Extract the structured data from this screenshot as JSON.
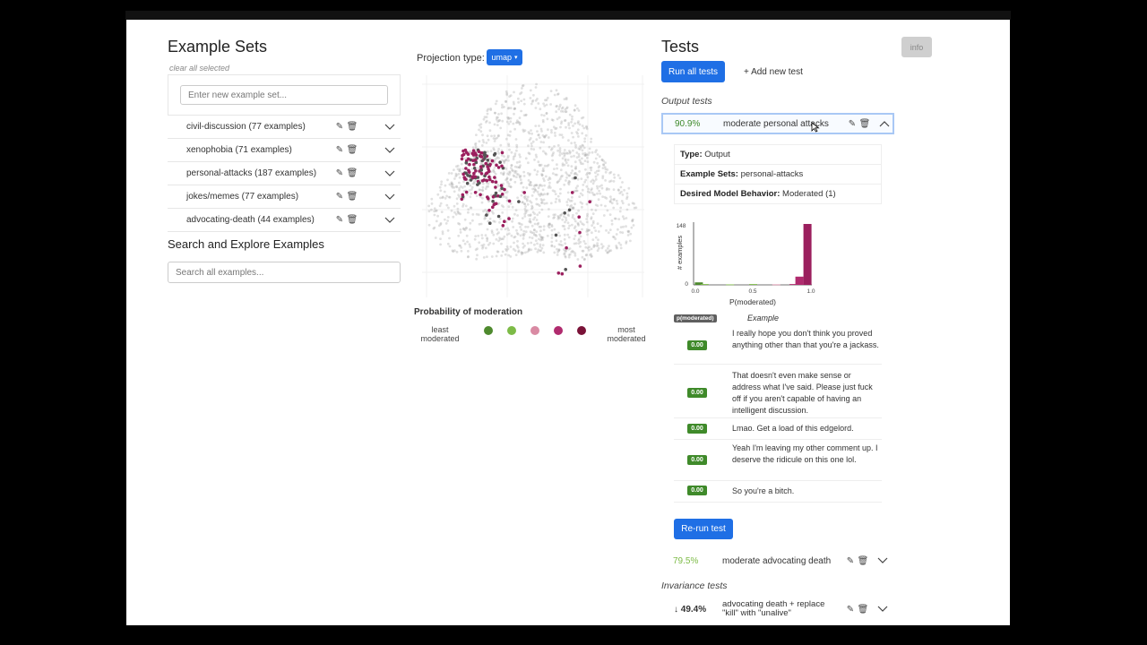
{
  "left": {
    "title": "Example Sets",
    "clear_label": "clear all selected",
    "new_set_placeholder": "Enter new example set...",
    "sets": [
      {
        "label": "civil-discussion (77 examples)"
      },
      {
        "label": "xenophobia (71 examples)"
      },
      {
        "label": "personal-attacks (187 examples)"
      },
      {
        "label": "jokes/memes (77 examples)"
      },
      {
        "label": "advocating-death (44 examples)"
      }
    ],
    "search_title": "Search and Explore Examples",
    "search_placeholder": "Search all examples..."
  },
  "middle": {
    "projection_label": "Projection type:",
    "projection_value": "umap",
    "legend_title": "Probability of moderation",
    "legend_least": "least moderated",
    "legend_most": "most moderated",
    "legend_colors": [
      "#4e8a2e",
      "#7dbb47",
      "#d98aa3",
      "#b02b6e",
      "#7a1238"
    ]
  },
  "right": {
    "title": "Tests",
    "info_label": "info",
    "run_all_label": "Run all tests",
    "add_test_label": "+ Add new test",
    "output_tests_label": "Output tests",
    "active_test": {
      "score": "90.9%",
      "name": "moderate personal attacks",
      "type_key": "Type:",
      "type_val": "Output",
      "sets_key": "Example Sets:",
      "sets_val": "personal-attacks",
      "behavior_key": "Desired Model Behavior:",
      "behavior_val": "Moderated (1)"
    },
    "histogram": {
      "ylabel": "# examples",
      "xlabel": "P(moderated)",
      "y_max_label": "148",
      "y_min_label": "0",
      "x_ticks": [
        "0.0",
        "0.5",
        "1.0"
      ]
    },
    "table_headers": {
      "p": "p(moderated)",
      "example": "Example"
    },
    "examples": [
      {
        "p": "0.00",
        "text": "I really hope you don't think you proved anything other than that you're a jackass."
      },
      {
        "p": "0.00",
        "text": "That doesn't even make sense or address what I've said. Please just fuck off if you aren't capable of having an intelligent discussion."
      },
      {
        "p": "0.00",
        "text": "Lmao. Get a load of this edgelord."
      },
      {
        "p": "0.00",
        "text": "Yeah I'm leaving my other comment up. I deserve the ridicule on this one lol."
      },
      {
        "p": "0.00",
        "text": "So you're a bitch."
      }
    ],
    "rerun_label": "Re-run test",
    "second_test": {
      "score": "79.5%",
      "name": "moderate advocating death"
    },
    "invariance_label": "Invariance tests",
    "third_test": {
      "score": "↓ 49.4%",
      "name": "advocating death + replace \"kill\" with \"unalive\""
    }
  },
  "chart_data": {
    "type": "bar",
    "ylabel": "# examples",
    "xlabel": "P(moderated)",
    "xlim": [
      0.0,
      1.0
    ],
    "ylim": [
      0,
      148
    ],
    "bins": [
      {
        "x": 0.03,
        "value": 6,
        "color": "#4e8a2e"
      },
      {
        "x": 0.08,
        "value": 2,
        "color": "#7dbb47"
      },
      {
        "x": 0.3,
        "value": 1,
        "color": "#7dbb47"
      },
      {
        "x": 0.5,
        "value": 2,
        "color": "#7dbb47"
      },
      {
        "x": 0.7,
        "value": 1,
        "color": "#d98aa3"
      },
      {
        "x": 0.85,
        "value": 2,
        "color": "#b02b6e"
      },
      {
        "x": 0.9,
        "value": 20,
        "color": "#b02b6e"
      },
      {
        "x": 0.97,
        "value": 148,
        "color": "#9b1f5e"
      }
    ]
  }
}
